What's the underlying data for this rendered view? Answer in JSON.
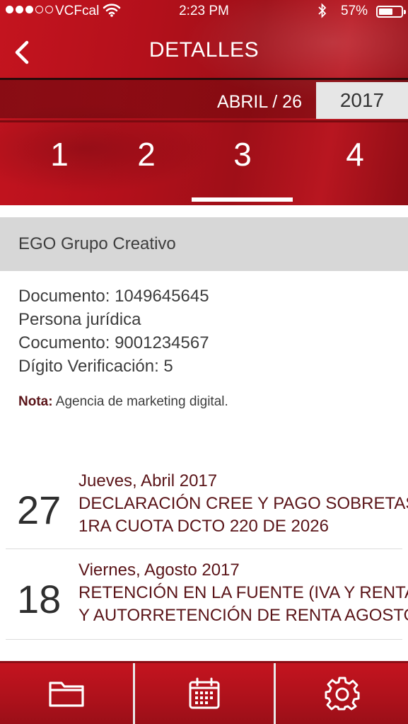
{
  "status_bar": {
    "carrier": "VCFcal",
    "time": "2:23 PM",
    "battery_percent": "57%",
    "battery_level": 0.57,
    "signal_bars_filled": 3,
    "signal_bars_total": 5
  },
  "header": {
    "title": "DETALLES",
    "back_icon": "chevron-left-icon"
  },
  "date_selector": {
    "month_day": "ABRIL / 26",
    "year": "2017"
  },
  "tabs": {
    "items": [
      {
        "label": "1"
      },
      {
        "label": "2"
      },
      {
        "label": "3"
      },
      {
        "label": "4"
      }
    ],
    "selected": "3"
  },
  "company": {
    "name": "EGO Grupo Creativo"
  },
  "details": {
    "lines": [
      "Documento: 1049645645",
      "Persona jurídica",
      "Cocumento: 9001234567",
      "Dígito Verificación: 5"
    ],
    "note_label": "Nota:",
    "note_text": " Agencia de marketing digital."
  },
  "events": [
    {
      "day": "27",
      "date": "Jueves, Abril 2017",
      "lines": [
        "DECLARACIÓN CREE Y PAGO SOBRETASA",
        "1RA CUOTA DCTO 220 DE 2026"
      ]
    },
    {
      "day": "18",
      "date": "Viernes, Agosto 2017",
      "lines": [
        "RETENCIÓN EN LA FUENTE (IVA Y RENTA)",
        "Y AUTORRETENCIÓN DE RENTA AGOSTO"
      ]
    }
  ],
  "toolbar": {
    "items": [
      {
        "icon": "folder-icon"
      },
      {
        "icon": "calendar-icon"
      },
      {
        "icon": "gear-icon"
      }
    ]
  },
  "colors": {
    "brand_red": "#b3101b",
    "accent_text": "#5a1418",
    "company_bar": "#d7d7d7"
  }
}
